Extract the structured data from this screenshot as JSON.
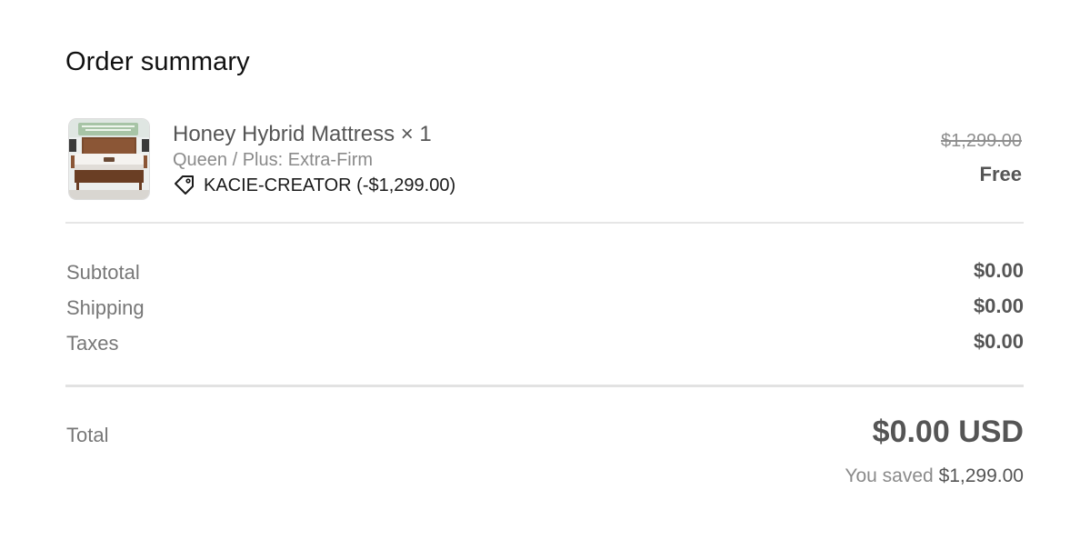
{
  "title": "Order summary",
  "item": {
    "name": "Honey Hybrid Mattress × 1",
    "variant": "Queen / Plus: Extra-Firm",
    "discount_code": "KACIE-CREATOR (-$1,299.00)",
    "original_price": "$1,299.00",
    "final_price": "Free",
    "thumbnail_icon": "mattress-image"
  },
  "summary": [
    {
      "label": "Subtotal",
      "value": "$0.00"
    },
    {
      "label": "Shipping",
      "value": "$0.00"
    },
    {
      "label": "Taxes",
      "value": "$0.00"
    }
  ],
  "total": {
    "label": "Total",
    "value": "$0.00 USD",
    "saved_prefix": "You saved",
    "saved_amount": "$1,299.00"
  },
  "colors": {
    "text_primary": "#111111",
    "text_secondary": "#555555",
    "text_muted": "#8a8a8a",
    "divider": "#e6e6e6"
  }
}
